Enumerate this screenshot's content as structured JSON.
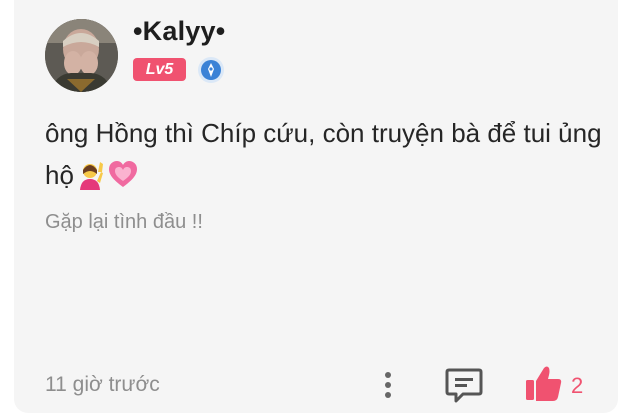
{
  "comment": {
    "username": "•Kalyy•",
    "level_badge": "Lv5",
    "text": "ông Hồng thì Chíp cứu, còn truyện bà để tui ủng hộ",
    "emojis": [
      "person-raising-hand-emoji",
      "growing-heart-emoji"
    ],
    "chapter_title": "Gặp lại tình đầu !!",
    "timestamp": "11 giờ trước",
    "like_count": "2"
  },
  "colors": {
    "accent_pink": "#f05270",
    "verify_blue": "#3b82d6",
    "muted_text": "#8e8e8e",
    "card_bg": "#f5f5f5"
  },
  "icons": {
    "more": "vertical-dots-icon",
    "reply": "comment-bubble-icon",
    "like": "thumbs-up-icon",
    "verified": "verified-badge-icon"
  }
}
